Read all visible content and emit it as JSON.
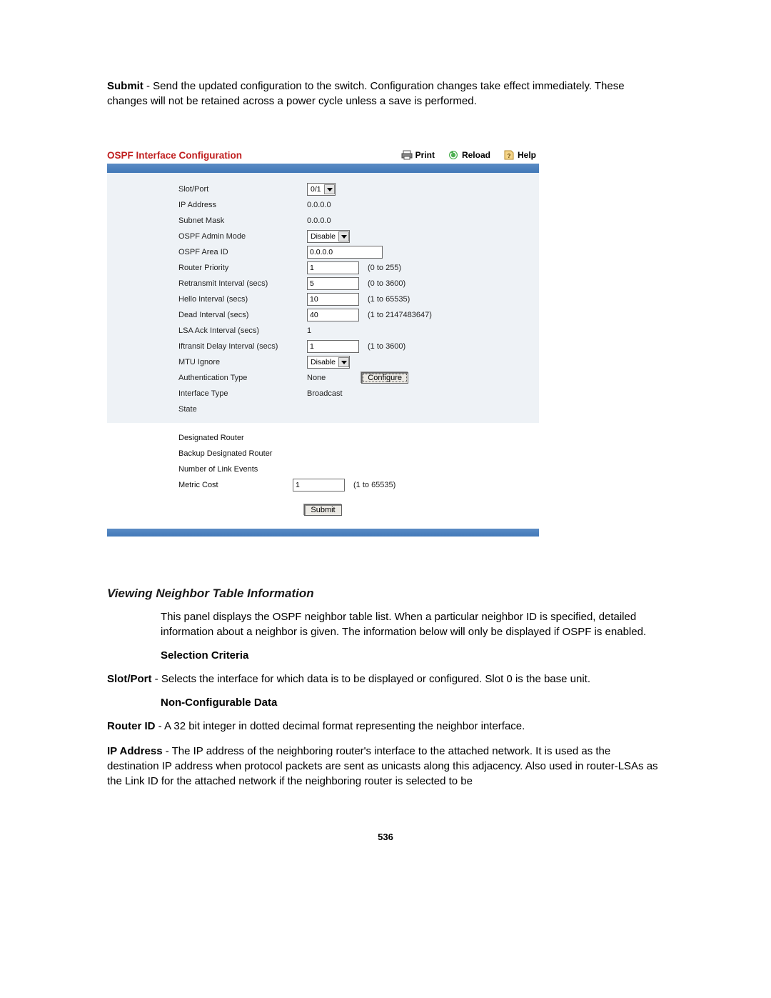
{
  "intro": {
    "bold": "Submit",
    "text": " - Send the updated configuration to the switch. Configuration changes take effect immediately. These changes will not be retained across a power cycle unless a save is performed."
  },
  "panel": {
    "title": "OSPF Interface Configuration",
    "actions": {
      "print": "Print",
      "reload": "Reload",
      "help": "Help"
    },
    "rows1": {
      "slot_port": {
        "label": "Slot/Port",
        "value": " 0/1"
      },
      "ip_address": {
        "label": "IP Address",
        "value": "0.0.0.0"
      },
      "subnet_mask": {
        "label": "Subnet Mask",
        "value": "0.0.0.0"
      },
      "admin_mode": {
        "label": "OSPF Admin Mode",
        "value": "Disable"
      },
      "area_id": {
        "label": "OSPF Area ID",
        "value": "0.0.0.0"
      },
      "router_priority": {
        "label": "Router Priority",
        "value": "1",
        "hint": "(0 to 255)"
      },
      "retransmit": {
        "label": "Retransmit Interval (secs)",
        "value": "5",
        "hint": "(0 to 3600)"
      },
      "hello": {
        "label": "Hello Interval (secs)",
        "value": "10",
        "hint": "(1 to 65535)"
      },
      "dead": {
        "label": "Dead Interval (secs)",
        "value": "40",
        "hint": "(1 to 2147483647)"
      },
      "lsa_ack": {
        "label": "LSA Ack Interval (secs)",
        "value": "1"
      },
      "iftransit": {
        "label": "Iftransit Delay Interval (secs)",
        "value": "1",
        "hint": "(1 to 3600)"
      },
      "mtu_ignore": {
        "label": "MTU Ignore",
        "value": "Disable"
      },
      "auth": {
        "label": "Authentication Type",
        "value": "None",
        "button": "Configure"
      },
      "iface_type": {
        "label": "Interface Type",
        "value": "Broadcast"
      },
      "state": {
        "label": "State"
      }
    },
    "rows2": {
      "designated": {
        "label": "Designated Router"
      },
      "backup": {
        "label": "Backup Designated Router"
      },
      "link_events": {
        "label": "Number of Link Events"
      },
      "metric": {
        "label": "Metric Cost",
        "value": "1",
        "hint": "(1 to 65535)"
      }
    },
    "submit": "Submit"
  },
  "body": {
    "heading": "Viewing Neighbor Table Information",
    "para1": "This panel displays the OSPF neighbor table list. When a particular neighbor ID is specified, detailed information about a neighbor is given. The information below will only be displayed if OSPF is enabled.",
    "sub1": "Selection Criteria",
    "slot_bold": "Slot/Port",
    "slot_text": " - Selects the interface for which data is to be displayed or configured. Slot 0 is the base unit.",
    "sub2": "Non-Configurable Data",
    "router_bold": "Router ID",
    "router_text": " - A 32 bit integer in dotted decimal format representing the neighbor interface.",
    "ip_bold": "IP Address",
    "ip_text": " - The IP address of the neighboring router's interface to the attached network. It is used as the destination IP address when protocol packets are sent as unicasts along this adjacency. Also used in router-LSAs as the Link ID for the attached network if the neighboring router is selected to be"
  },
  "page_number": "536"
}
